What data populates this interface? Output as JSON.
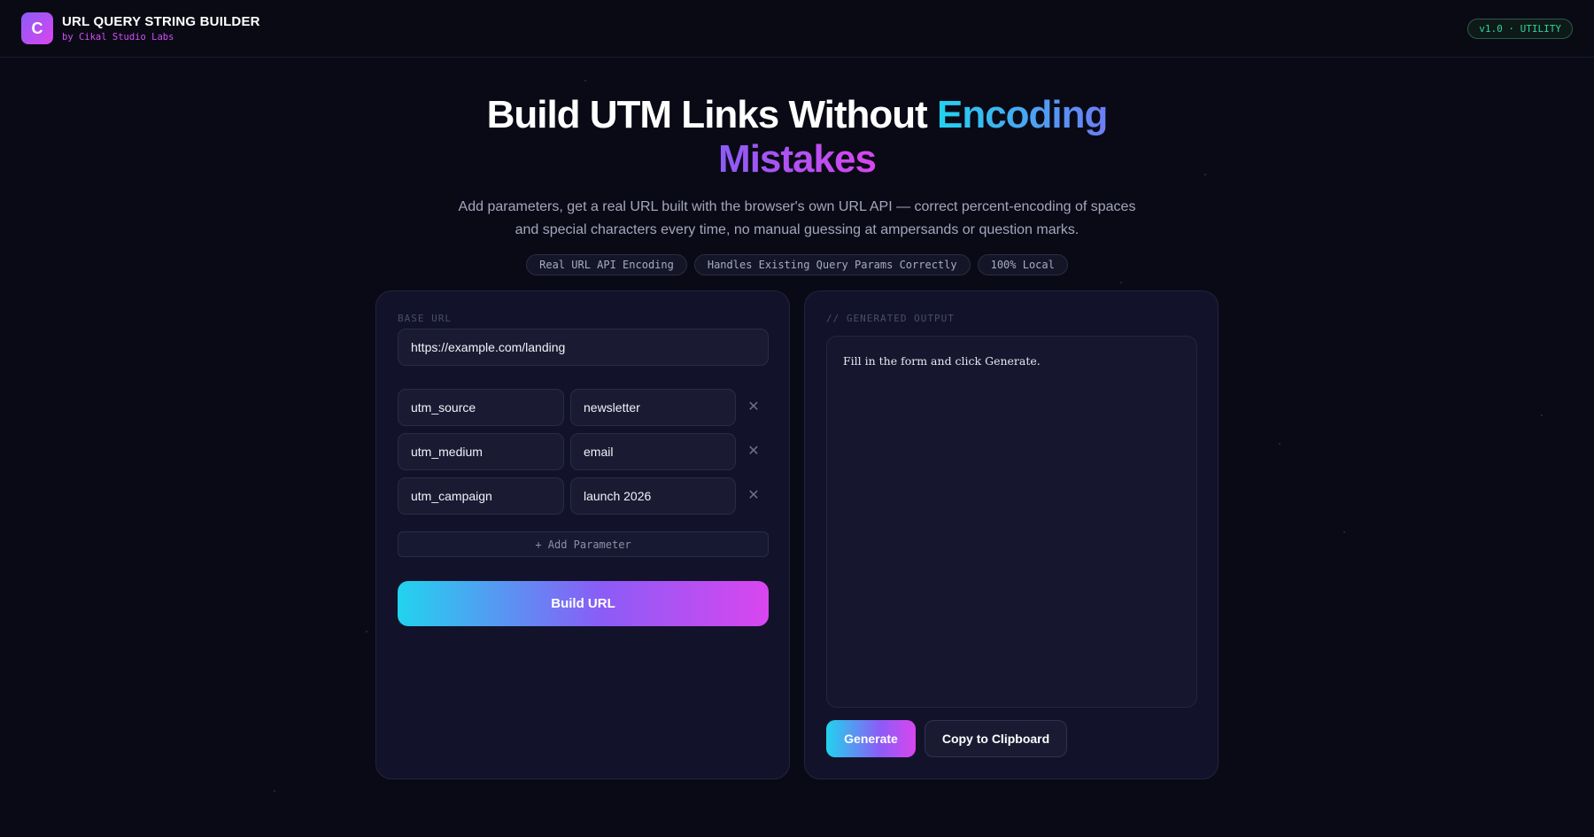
{
  "header": {
    "logo_letter": "C",
    "title": "URL QUERY STRING BUILDER",
    "subtitle": "by Cikal Studio Labs",
    "version_badge": "v1.0 · UTILITY"
  },
  "hero": {
    "title_plain": "Build UTM Links Without ",
    "title_accent_1": "Encoding",
    "title_accent_2": "Mistakes",
    "description": "Add parameters, get a real URL built with the browser's own URL API — correct percent-encoding of spaces and special characters every time, no manual guessing at ampersands or question marks.",
    "chips": [
      "Real URL API Encoding",
      "Handles Existing Query Params Correctly",
      "100% Local"
    ]
  },
  "form": {
    "base_url_label": "BASE URL",
    "base_url_value": "https://example.com/landing",
    "params": [
      {
        "key": "utm_source",
        "value": "newsletter"
      },
      {
        "key": "utm_medium",
        "value": "email"
      },
      {
        "key": "utm_campaign",
        "value": "launch 2026"
      }
    ],
    "remove_symbol": "✕",
    "add_param_label": "+ Add Parameter",
    "build_label": "Build URL"
  },
  "output": {
    "label": "// GENERATED OUTPUT",
    "placeholder": "Fill in the form and click Generate.",
    "generate_label": "Generate",
    "copy_label": "Copy to Clipboard"
  },
  "colors": {
    "background": "#0a0a16",
    "accent_cyan": "#22d3ee",
    "accent_violet": "#8b5cf6",
    "accent_magenta": "#d946ef",
    "badge_green": "#34d399"
  }
}
